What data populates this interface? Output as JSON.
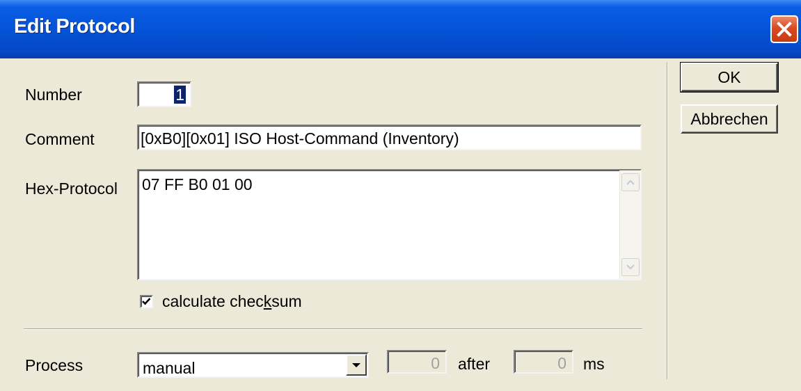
{
  "window": {
    "title": "Edit Protocol",
    "close_icon": "close-icon",
    "title_bar_color": "#0553d6",
    "close_button_color": "#d84b22"
  },
  "form": {
    "number": {
      "label": "Number",
      "value": "1"
    },
    "comment": {
      "label": "Comment",
      "value": "[0xB0][0x01] ISO Host-Command (Inventory)"
    },
    "hex_protocol": {
      "label": "Hex-Protocol",
      "value": "07 FF B0 01 00"
    },
    "checksum": {
      "label_before": "calculate chec",
      "label_accel": "k",
      "label_after": "sum",
      "checked": true
    },
    "process": {
      "label": "Process",
      "selected": "manual",
      "delay_value": "0",
      "after_label": "after",
      "ms_value": "0",
      "ms_label": "ms"
    }
  },
  "buttons": {
    "ok": "OK",
    "cancel": "Abbrechen"
  }
}
